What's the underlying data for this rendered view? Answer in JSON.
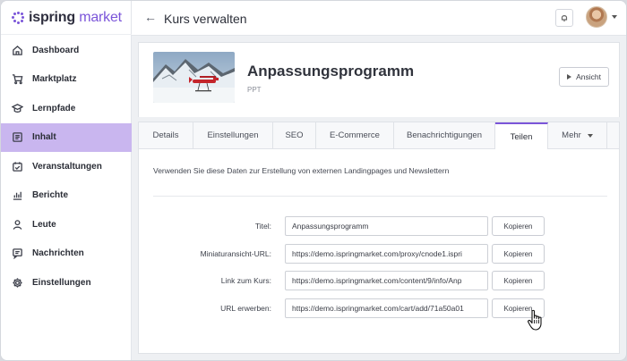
{
  "brand": {
    "logo_bold": "ispring",
    "logo_accent": "market",
    "accent_color": "#7b55d9"
  },
  "sidebar": {
    "items": [
      {
        "label": "Dashboard",
        "icon": "home-icon",
        "active": false
      },
      {
        "label": "Marktplatz",
        "icon": "cart-icon",
        "active": false
      },
      {
        "label": "Lernpfade",
        "icon": "graduation-cap-icon",
        "active": false
      },
      {
        "label": "Inhalt",
        "icon": "document-icon",
        "active": true
      },
      {
        "label": "Veranstaltungen",
        "icon": "calendar-check-icon",
        "active": false
      },
      {
        "label": "Berichte",
        "icon": "bar-chart-icon",
        "active": false
      },
      {
        "label": "Leute",
        "icon": "person-icon",
        "active": false
      },
      {
        "label": "Nachrichten",
        "icon": "message-icon",
        "active": false
      },
      {
        "label": "Einstellungen",
        "icon": "gear-icon",
        "active": false
      }
    ]
  },
  "header": {
    "back_icon": "←",
    "title": "Kurs verwalten"
  },
  "course": {
    "title": "Anpassungsprogramm",
    "type": "PPT",
    "view_label": "Ansicht"
  },
  "tabs": [
    {
      "label": "Details"
    },
    {
      "label": "Einstellungen"
    },
    {
      "label": "SEO"
    },
    {
      "label": "E-Commerce"
    },
    {
      "label": "Benachrichtigungen"
    },
    {
      "label": "Teilen"
    },
    {
      "label": "Mehr"
    }
  ],
  "share": {
    "intro": "Verwenden Sie diese Daten zur Erstellung von externen Landingpages und Newslettern",
    "copy_label": "Kopieren",
    "rows": [
      {
        "label": "Titel:",
        "value": "Anpassungsprogramm"
      },
      {
        "label": "Miniaturansicht-URL:",
        "value": "https://demo.ispringmarket.com/proxy/cnode1.ispri"
      },
      {
        "label": "Link zum Kurs:",
        "value": "https://demo.ispringmarket.com/content/9/info/Anp"
      },
      {
        "label": "URL erwerben:",
        "value": "https://demo.ispringmarket.com/cart/add/71a50a01"
      }
    ]
  }
}
